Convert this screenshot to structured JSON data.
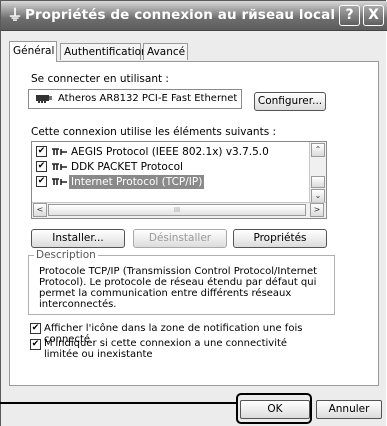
{
  "window": {
    "title": "Propriétés de connexion au rйseau local",
    "help_label": "?",
    "close_label": "X"
  },
  "tabs": [
    {
      "label": "Général",
      "active": true
    },
    {
      "label": "Authentification",
      "active": false
    },
    {
      "label": "Avancé",
      "active": false
    }
  ],
  "connect_using": {
    "label": "Se connecter en utilisant :",
    "adapter": "Atheros AR8132 PCI-E Fast Ethernet",
    "configure_label": "Configurer..."
  },
  "components": {
    "label": "Cette connexion utilise les éléments suivants :",
    "items": [
      {
        "label": "AEGIS Protocol (IEEE 802.1x) v3.7.5.0",
        "checked": true,
        "selected": false
      },
      {
        "label": "DDK PACKET Protocol",
        "checked": true,
        "selected": false
      },
      {
        "label": "Internet Protocol (TCP/IP)",
        "checked": true,
        "selected": true
      }
    ],
    "scroll_up_glyph": "⌃",
    "scroll_down_glyph": "⌄",
    "scroll_left_glyph": "<",
    "scroll_right_glyph": ">",
    "scroll_grip": "III"
  },
  "actions": {
    "install_label": "Installer...",
    "uninstall_label": "Désinstaller",
    "properties_label": "Propriétés"
  },
  "description": {
    "legend": "Description",
    "text": "Protocole TCP/IP (Transmission Control Protocol/Internet Protocol). Le protocole de réseau étendu par défaut qui permet la communication entre différents réseaux interconnectés."
  },
  "options": [
    {
      "label": "Afficher l'icône dans la zone de notification une fois connecté",
      "checked": true
    },
    {
      "label": "M'indiquer si cette connexion a une connectivité limitée ou inexistante",
      "checked": true
    }
  ],
  "footer": {
    "ok_label": "OK",
    "cancel_label": "Annuler"
  },
  "check_glyph": "✔",
  "colors": {
    "titlebar": "#6e6e6e",
    "selection": "#8a8a8a",
    "callout": "#000000"
  }
}
